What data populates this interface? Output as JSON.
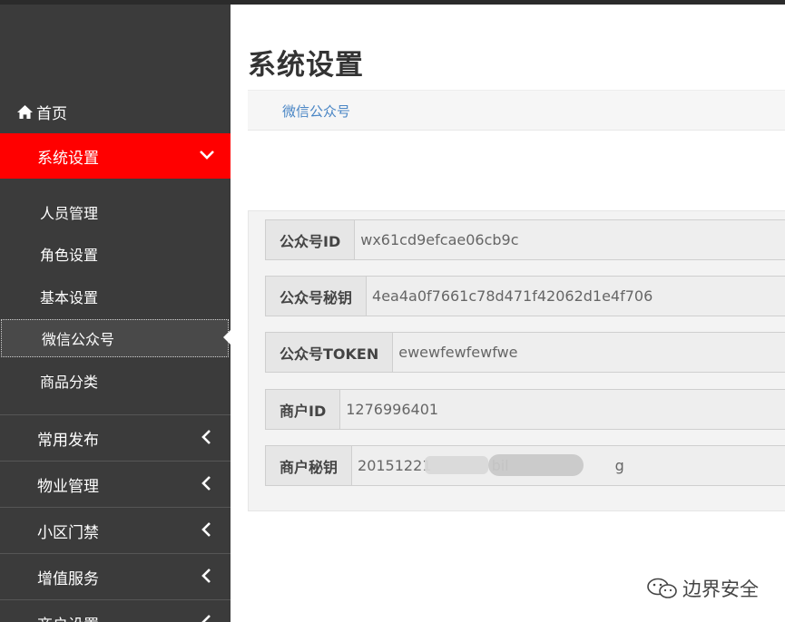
{
  "sidebar": {
    "home_label": "首页",
    "active_section": {
      "label": "系统设置"
    },
    "subitems": [
      {
        "label": "人员管理"
      },
      {
        "label": "角色设置"
      },
      {
        "label": "基本设置"
      },
      {
        "label": "微信公众号"
      },
      {
        "label": "商品分类"
      }
    ],
    "sections": [
      {
        "label": "常用发布"
      },
      {
        "label": "物业管理"
      },
      {
        "label": "小区门禁"
      },
      {
        "label": "增值服务"
      },
      {
        "label": "商户设置"
      }
    ]
  },
  "main": {
    "page_title": "系统设置",
    "tab_label": "微信公众号",
    "fields": [
      {
        "label": "公众号ID",
        "value": "wx61cd9efcae06cb9c"
      },
      {
        "label": "公众号秘钥",
        "value": "4ea4a0f7661c78d471f42062d1e4f706"
      },
      {
        "label": "公众号TOKEN",
        "value": "ewewfewfewfwe"
      },
      {
        "label": "商户ID",
        "value": "1276996401"
      },
      {
        "label": "商户秘钥",
        "value": "20151221             bil                       g"
      }
    ]
  },
  "watermark": {
    "text": "边界安全"
  },
  "colors": {
    "sidebar_bg": "#3b3b3b",
    "active_section_bg": "#ff0000",
    "tab_link": "#4a86c5"
  }
}
